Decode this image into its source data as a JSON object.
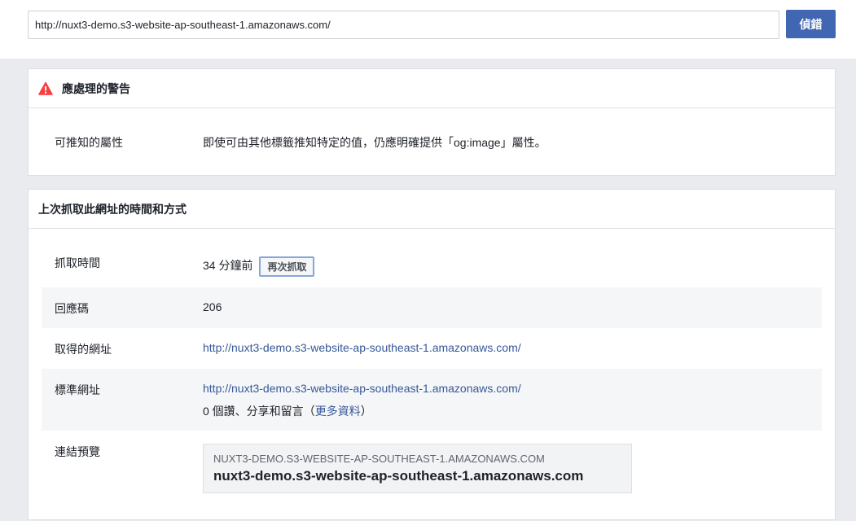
{
  "search": {
    "url_value": "http://nuxt3-demo.s3-website-ap-southeast-1.amazonaws.com/",
    "debug_label": "偵錯"
  },
  "warnings": {
    "title": "應處理的警告",
    "icon": "warning-icon",
    "icon_color": "#fa3e3e",
    "rows": [
      {
        "label": "可推知的屬性",
        "value": "即使可由其他標籤推知特定的值，仍應明確提供「og:image」屬性。"
      }
    ]
  },
  "fetch": {
    "title": "上次抓取此網址的時間和方式",
    "fetch_time": {
      "label": "抓取時間",
      "value": "34 分鐘前",
      "refetch_label": "再次抓取"
    },
    "response_code": {
      "label": "回應碼",
      "value": "206"
    },
    "fetched_url": {
      "label": "取得的網址",
      "value": "http://nuxt3-demo.s3-website-ap-southeast-1.amazonaws.com/"
    },
    "canonical_url": {
      "label": "標準網址",
      "value": "http://nuxt3-demo.s3-website-ap-southeast-1.amazonaws.com/",
      "engagement_prefix": "0 個讚、分享和留言（",
      "engagement_link": "更多資料",
      "engagement_suffix": "）"
    },
    "link_preview": {
      "label": "連結預覽",
      "domain": "NUXT3-DEMO.S3-WEBSITE-AP-SOUTHEAST-1.AMAZONAWS.COM",
      "title": "nuxt3-demo.s3-website-ap-southeast-1.amazonaws.com"
    }
  },
  "colors": {
    "accent": "#4267b2",
    "link": "#365899",
    "page_bg": "#e9ebee"
  }
}
